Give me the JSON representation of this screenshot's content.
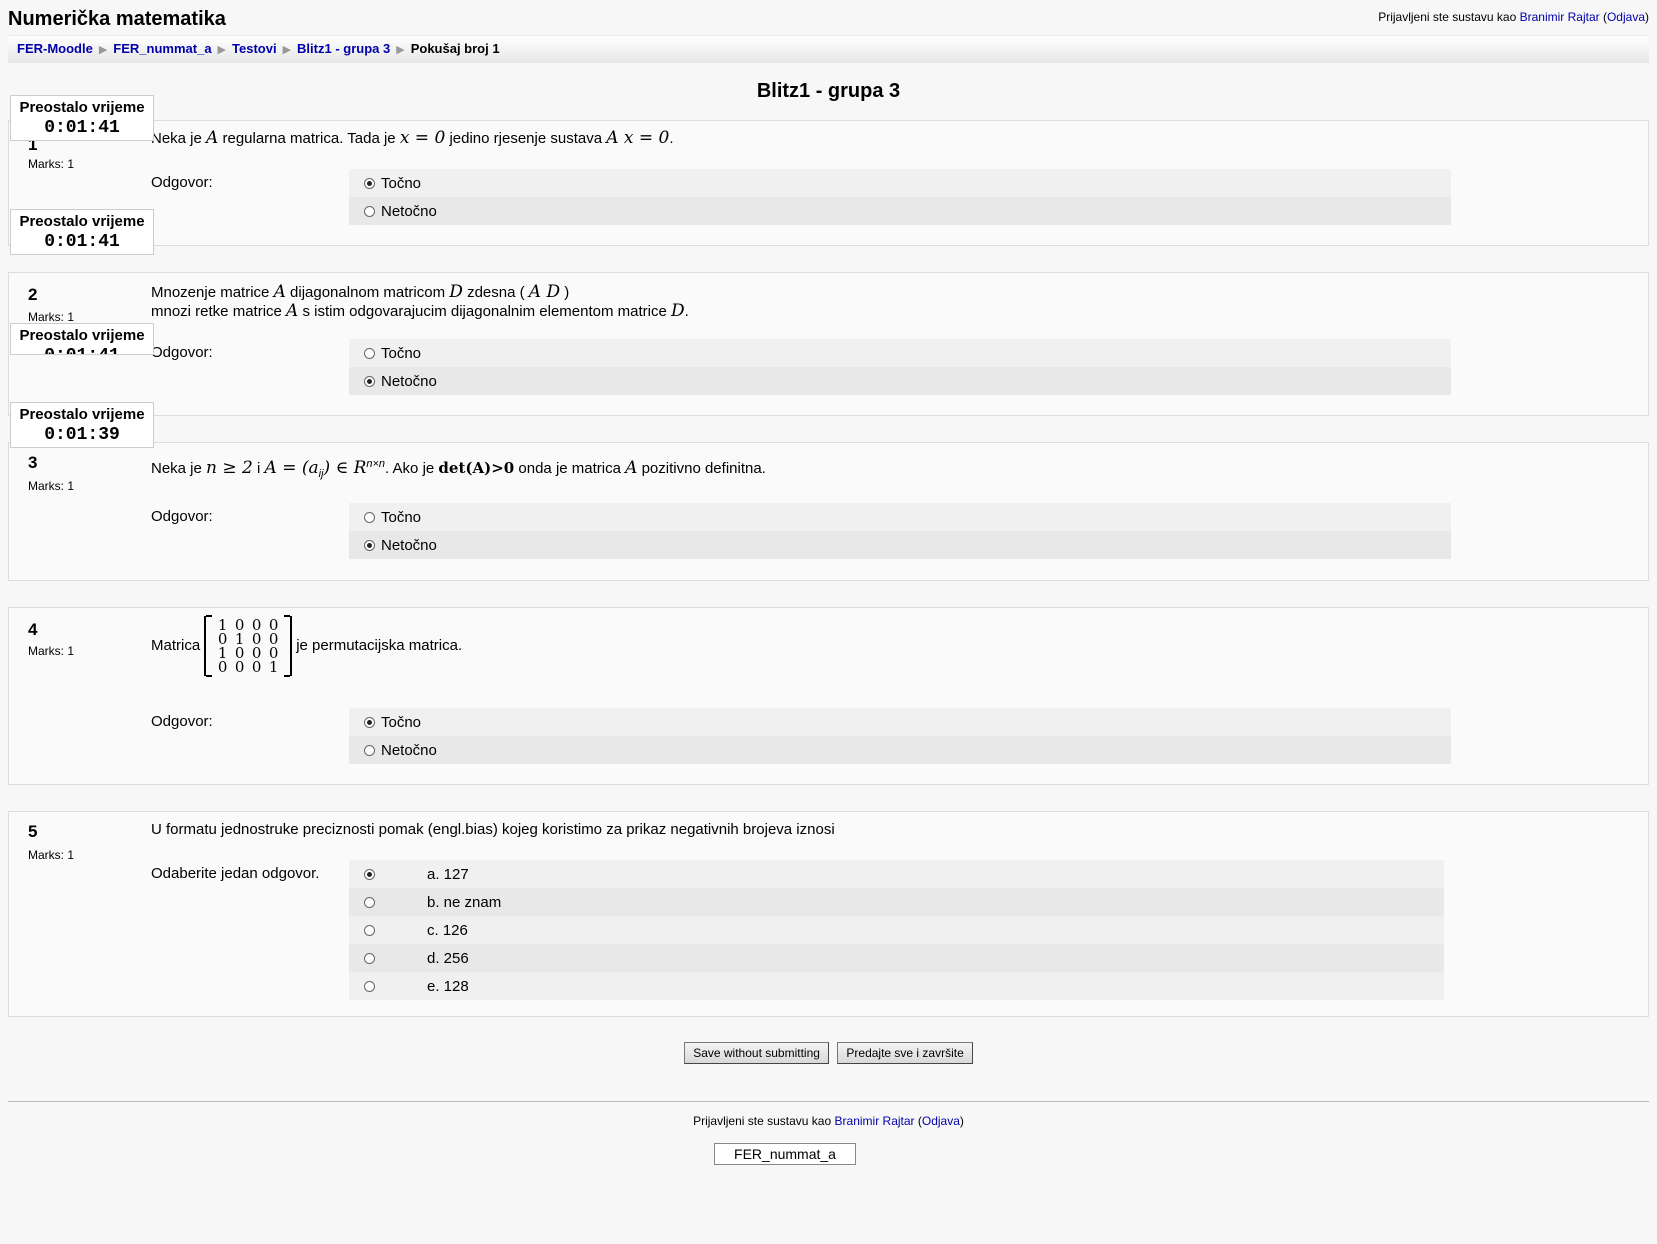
{
  "header": {
    "site_title": "Numerička matematika",
    "login_prefix": "Prijavljeni ste sustavu kao",
    "user_name": "Branimir Rajtar",
    "logout_label": "Odjava"
  },
  "breadcrumb": {
    "items": [
      "FER-Moodle",
      "FER_nummat_a",
      "Testovi",
      "Blitz1 - grupa 3"
    ],
    "current": "Pokušaj broj 1"
  },
  "quiz_title": "Blitz1 - grupa 3",
  "timer": {
    "label": "Preostalo vrijeme",
    "values": [
      "0:01:41",
      "0:01:41",
      "0:01:41",
      "0:01:39"
    ]
  },
  "questions": [
    {
      "number": "1",
      "marks": "Marks: 1",
      "text_parts": [
        "Neka je",
        "A",
        "regularna matrica. Tada je",
        "x = 0",
        "jedino rjesenje sustava",
        "A x = 0",
        "."
      ],
      "answer_label": "Odgovor:",
      "options": [
        {
          "label": "Točno",
          "selected": true
        },
        {
          "label": "Netočno",
          "selected": false
        }
      ]
    },
    {
      "number": "2",
      "marks": "Marks: 1",
      "text_parts": [
        "Mnozenje matrice",
        "A",
        "dijagonalnom matricom",
        "D",
        "zdesna (",
        "A D",
        ")",
        "mnozi retke matrice",
        "A",
        "s istim odgovarajucim dijagonalnim elementom matrice",
        "D",
        "."
      ],
      "answer_label": "Odgovor:",
      "options": [
        {
          "label": "Točno",
          "selected": false
        },
        {
          "label": "Netočno",
          "selected": true
        }
      ]
    },
    {
      "number": "3",
      "marks": "Marks: 1",
      "text_parts": [
        "Neka je",
        "n ≥ 2",
        "i",
        "A = (a",
        "ij",
        ") ∈ R",
        "n×n",
        ". Ako je",
        "det(A)>0",
        "onda je matrica",
        "A",
        "pozitivno definitna."
      ],
      "answer_label": "Odgovor:",
      "options": [
        {
          "label": "Točno",
          "selected": false
        },
        {
          "label": "Netočno",
          "selected": true
        }
      ]
    },
    {
      "number": "4",
      "marks": "Marks: 1",
      "text_parts": [
        "Matrica",
        "je permutacijska matrica."
      ],
      "matrix": [
        [
          "1",
          "0",
          "0",
          "0"
        ],
        [
          "0",
          "1",
          "0",
          "0"
        ],
        [
          "1",
          "0",
          "0",
          "0"
        ],
        [
          "0",
          "0",
          "0",
          "1"
        ]
      ],
      "answer_label": "Odgovor:",
      "options": [
        {
          "label": "Točno",
          "selected": true
        },
        {
          "label": "Netočno",
          "selected": false
        }
      ]
    },
    {
      "number": "5",
      "marks": "Marks: 1",
      "text": "U formatu jednostruke preciznosti pomak (engl.bias) kojeg koristimo za prikaz negativnih brojeva iznosi",
      "answer_label": "Odaberite jedan odgovor.",
      "options": [
        {
          "label": "a. 127",
          "selected": true
        },
        {
          "label": "b. ne znam",
          "selected": false
        },
        {
          "label": "c. 126",
          "selected": false
        },
        {
          "label": "d. 256",
          "selected": false
        },
        {
          "label": "e. 128",
          "selected": false
        }
      ]
    }
  ],
  "buttons": {
    "save": "Save without submitting",
    "submit": "Predajte sve i završite"
  },
  "footer": {
    "login_prefix": "Prijavljeni ste sustavu kao",
    "user_name": "Branimir Rajtar",
    "logout_label": "Odjava",
    "course_button": "FER_nummat_a"
  }
}
